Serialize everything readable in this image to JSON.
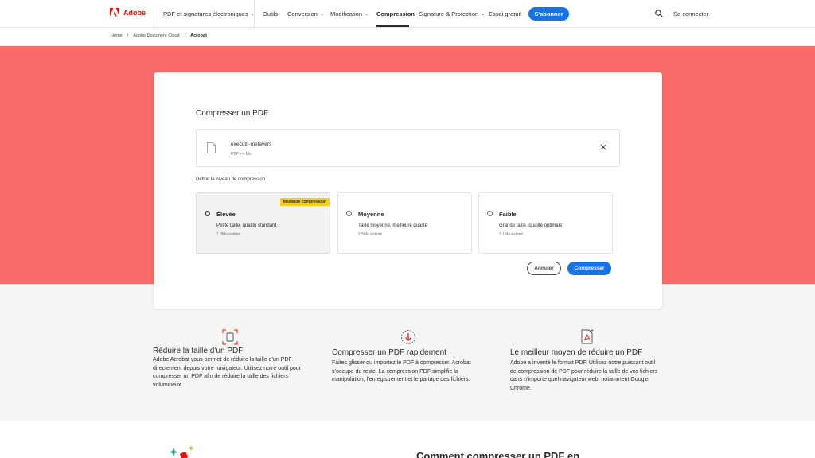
{
  "nav": {
    "brand": "Adobe",
    "items": [
      {
        "label": "PDF et signatures électroniques",
        "chevron": true
      },
      {
        "label": "Outils",
        "chevron": false
      },
      {
        "label": "Conversion",
        "chevron": true
      },
      {
        "label": "Modification",
        "chevron": true
      },
      {
        "label": "Compression",
        "chevron": false,
        "active": true
      },
      {
        "label": "Signature & Protection",
        "chevron": true
      },
      {
        "label": "Essai gratuit",
        "chevron": false
      }
    ],
    "subscribe": "S'abonner",
    "signin": "Se connecter"
  },
  "breadcrumb": [
    "Home",
    "Adobe Document Cloud",
    "Acrobat"
  ],
  "card": {
    "title": "Compresser un PDF",
    "file": {
      "name": "executif-metavers",
      "meta": "PDF • 4 Mo"
    },
    "level_label": "Définir le niveau de compression :",
    "options": [
      {
        "title": "Élevée",
        "desc": "Petite taille, qualité standard",
        "estimate": "1.3Mo estimé",
        "badge": "Meilleure compression",
        "selected": true
      },
      {
        "title": "Moyenne",
        "desc": "Taille moyenne, meilleure qualité",
        "estimate": "2.5Mo estimé",
        "selected": false
      },
      {
        "title": "Faible",
        "desc": "Grande taille, qualité optimale",
        "estimate": "3.1Mo estimé",
        "selected": false
      }
    ],
    "cancel": "Annuler",
    "compress": "Compresser"
  },
  "features": [
    {
      "icon": "compress-frame-icon",
      "title": "Réduire la taille d’un PDF",
      "body": "Adobe Acrobat vous permet de réduire la taille d’un PDF directement depuis votre navigateur. Utilisez notre outil pour compresser un PDF afin de réduire la taille des fichiers volumineux."
    },
    {
      "icon": "download-arrow-icon",
      "title": "Compresser un PDF rapidement",
      "body": "Faites glisser ou importez le PDF à compresser. Acrobat s’occupe du reste. La compression PDF simplifie la manipulation, l’enregistrement et le partage des fichiers."
    },
    {
      "icon": "pdf-file-icon",
      "title": "Le meilleur moyen de réduire un PDF",
      "body": "Adobe a inventé le format PDF. Utilisez notre puissant outil de compression de PDF pour réduire la taille de vos fichiers dans n’importe quel navigateur web, notamment Google Chrome."
    }
  ],
  "bottom": {
    "title": "Comment compresser un PDF en"
  },
  "colors": {
    "hero": "#fa6a69",
    "accent": "#1473e6",
    "badge": "#f7cd1e",
    "brand": "#eb1000"
  }
}
